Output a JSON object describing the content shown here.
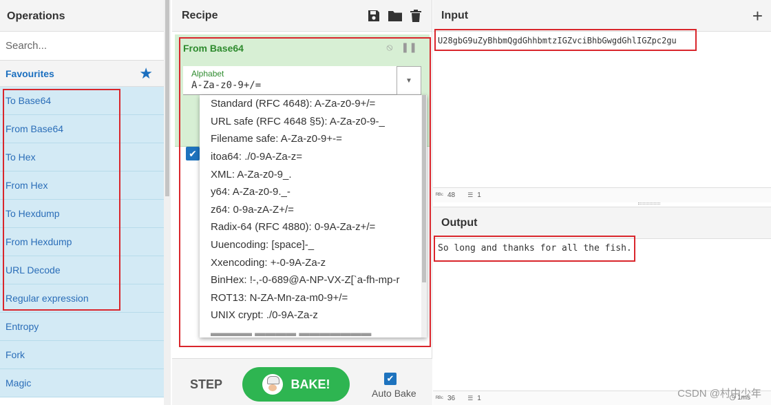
{
  "operations": {
    "title": "Operations",
    "search_placeholder": "Search...",
    "favourites_label": "Favourites",
    "items": [
      "To Base64",
      "From Base64",
      "To Hex",
      "From Hex",
      "To Hexdump",
      "From Hexdump",
      "URL Decode",
      "Regular expression",
      "Entropy",
      "Fork",
      "Magic"
    ]
  },
  "recipe": {
    "title": "Recipe",
    "operation": {
      "name": "From Base64",
      "alphabet_label": "Alphabet",
      "alphabet_value": "A-Za-z0-9+/="
    },
    "alphabet_options": [
      "Standard (RFC 4648): A-Za-z0-9+/=",
      "URL safe (RFC 4648 §5): A-Za-z0-9-_",
      "Filename safe: A-Za-z0-9+-=",
      "itoa64: ./0-9A-Za-z=",
      "XML: A-Za-z0-9_.",
      "y64: A-Za-z0-9._-",
      "z64: 0-9a-zA-Z+/=",
      "Radix-64 (RFC 4880): 0-9A-Za-z+/=",
      "Uuencoding: [space]-_",
      "Xxencoding: +-0-9A-Za-z",
      "BinHex: !-,-0-689@A-NP-VX-Z[`a-fh-mp-r",
      "ROT13: N-ZA-Mn-za-m0-9+/=",
      "UNIX crypt: ./0-9A-Za-z"
    ],
    "step_label": "STEP",
    "bake_label": "BAKE!",
    "autobake_label": "Auto Bake"
  },
  "input": {
    "title": "Input",
    "text": "U28gbG9uZyBhbmQgdGhhbmtzIGZvciBhbGwgdGhlIGZpc2gu",
    "length": "48",
    "lines": "1"
  },
  "output": {
    "title": "Output",
    "text": "So long and thanks for all the fish.",
    "length": "36",
    "lines": "1",
    "time": "1ms"
  },
  "watermark": "CSDN @村中少年",
  "colors": {
    "accent_blue": "#1b6fbf",
    "op_item_bg": "#d3eaf5",
    "op_card_bg": "#d7efd4",
    "bake_green": "#2eb551",
    "highlight_red": "#d9252b"
  }
}
